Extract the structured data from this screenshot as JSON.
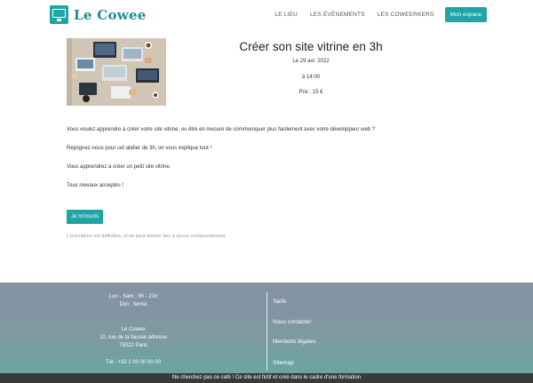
{
  "header": {
    "logo_text": "Le Cowee",
    "nav": [
      "LE LIEU",
      "LES ÉVÉNEMENTS",
      "LES COWEERKERS"
    ],
    "account_button": "Mon espace"
  },
  "event": {
    "title": "Créer son site vitrine en 3h",
    "date": "Le 29 avr. 2022",
    "time": "à 14:00",
    "price": "Prix : 15 €",
    "paragraphs": [
      "Vous voulez apprendre à créer votre site vitrine, ou être en mesure de communiquer plus facilement avec votre développeur web ?",
      "Rejoignez-nous pour cet atelier de 3h, on vous explique tout !",
      "Vous apprendrez à créer un petit site vitrine.",
      "Tous niveaux acceptés !"
    ],
    "signup_button": "Je m'inscris",
    "note": "L'inscription est définitive, et ne peut donner lieu à aucun remboursement."
  },
  "footer": {
    "hours_line1": "Lun - Sam : 9h - 21h",
    "hours_line2": "Dim : fermé",
    "name": "Le Cowee",
    "street": "10, rue de la fausse adresse",
    "city": "75022 Paris",
    "phone": "Tél : +33 1 00 00 00 00",
    "links": [
      "Tarifs",
      "Nous contacter",
      "Mentions légales",
      "Sitemap"
    ],
    "disclaimer": "Ne cherchez pas ce café ! Ce site est fictif et créé dans le cadre d'une formation"
  }
}
